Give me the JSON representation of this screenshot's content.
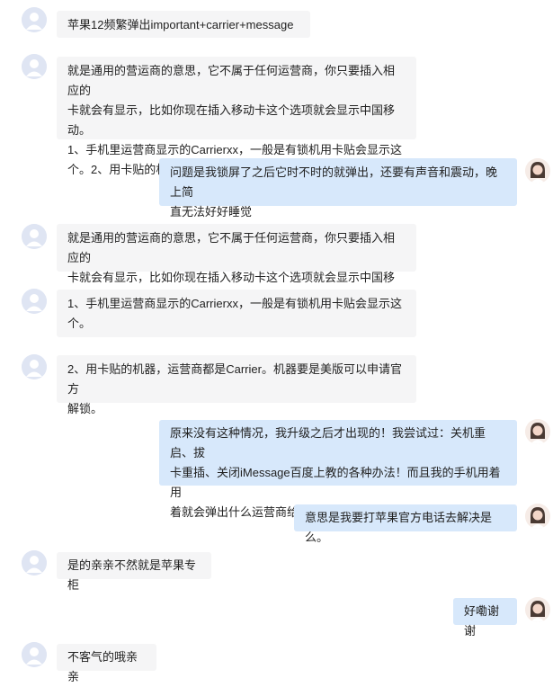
{
  "colors": {
    "user_bubble": "#d7e8fb",
    "agent_bubble": "#f5f5f6",
    "background": "#ffffff"
  },
  "messages": [
    {
      "side": "left",
      "text": "苹果12频繁弹出important+carrier+message"
    },
    {
      "side": "left",
      "lines": [
        "就是通用的营运商的意思，它不属于任何运营商，你只要插入相应的",
        "卡就会有显示，比如你现在插入移动卡这个选项就会显示中国移动。",
        "1、手机里运营商显示的Carrierxx，一般是有锁机用卡贴会显示这",
        "个。2、用卡贴的机器，运营商都是Carrier。"
      ]
    },
    {
      "side": "right",
      "lines": [
        "问题是我锁屏了之后它时不时的就弹出，还要有声音和震动，晚上简",
        "直无法好好睡觉"
      ]
    },
    {
      "side": "left",
      "lines": [
        "就是通用的营运商的意思，它不属于任何运营商，你只要插入相应的",
        "卡就会有显示，比如你现在插入移动卡这个选项就会显示中国移动。"
      ]
    },
    {
      "side": "left",
      "lines": [
        "1、手机里运营商显示的Carrierxx，一般是有锁机用卡贴会显示这",
        "个。"
      ]
    },
    {
      "side": "left",
      "lines": [
        "2、用卡贴的机器，运营商都是Carrier。机器要是美版可以申请官方",
        "解锁。"
      ]
    },
    {
      "side": "right",
      "lines": [
        "原来没有这种情况，我升级之后才出现的！我尝试过：关机重启、拔",
        "卡重插、关闭iMessage百度上教的各种办法！而且我的手机用着用",
        "着就会弹出什么运营商给你发来一条信息"
      ]
    },
    {
      "side": "right",
      "text": "意思是我要打苹果官方电话去解决是么。"
    },
    {
      "side": "left",
      "text": "是的亲亲不然就是苹果专柜"
    },
    {
      "side": "right",
      "text": "好嘞谢谢"
    },
    {
      "side": "left",
      "text": "不客气的哦亲亲"
    }
  ]
}
